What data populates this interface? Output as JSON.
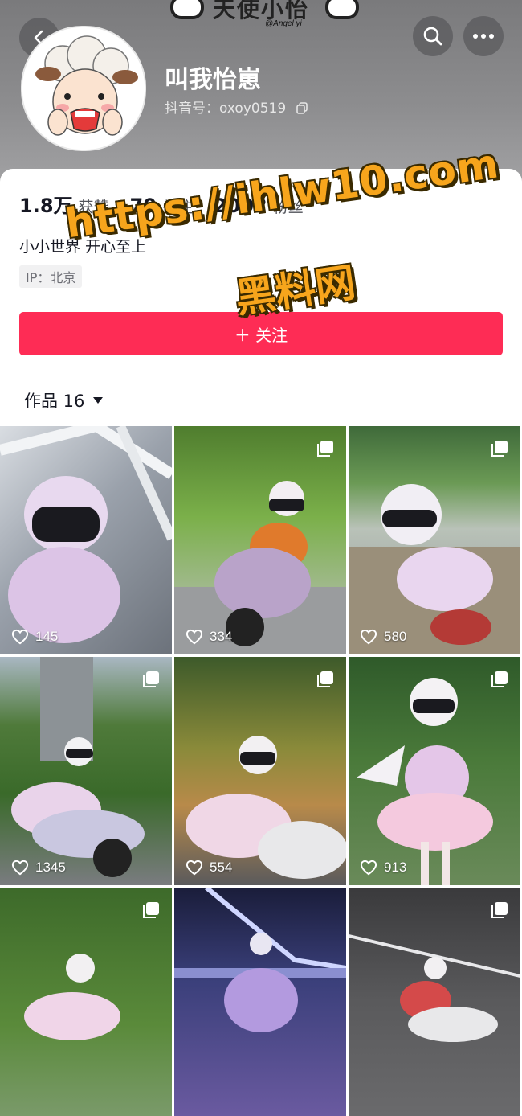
{
  "banner": {
    "title": "天使小怡",
    "subtitle": "@Angel  yi"
  },
  "nav": {
    "back_icon": "chevron-left-icon",
    "search_icon": "search-icon",
    "more_icon": "more-horizontal-icon"
  },
  "profile": {
    "name": "叫我怡崽",
    "handle": "抖音号：oxoy0519",
    "avatar_icon": "cartoon-sheep-avatar"
  },
  "stats": [
    {
      "value": "1.8万",
      "label": "获赞"
    },
    {
      "value": "70",
      "label": "关注"
    },
    {
      "value": "2002",
      "label": "粉丝"
    }
  ],
  "bio": "小小世界 开心至上",
  "ip_tag": "IP：北京",
  "follow_button": "＋ 关注",
  "works_tab": "作品 16",
  "watermark": {
    "url": "https://ihlw10.com",
    "name": "黑料网"
  },
  "colors": {
    "accent": "#fe2c55",
    "watermark": "#f7a51c"
  },
  "posts": [
    {
      "likes": "145",
      "multi_image": false
    },
    {
      "likes": "334",
      "multi_image": true
    },
    {
      "likes": "580",
      "multi_image": true
    },
    {
      "likes": "1345",
      "multi_image": true
    },
    {
      "likes": "554",
      "multi_image": true
    },
    {
      "likes": "913",
      "multi_image": true
    },
    {
      "likes": "",
      "multi_image": true
    },
    {
      "likes": "",
      "multi_image": false
    },
    {
      "likes": "",
      "multi_image": true
    }
  ]
}
